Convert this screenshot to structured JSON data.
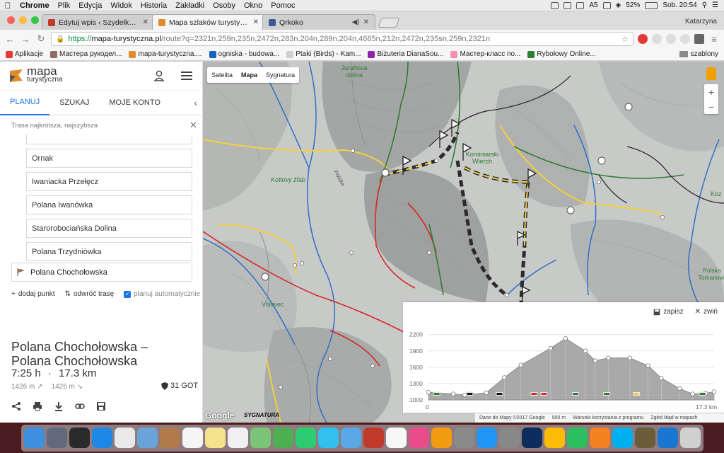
{
  "menubar": {
    "app": "Chrome",
    "items": [
      "Plik",
      "Edycja",
      "Widok",
      "Historia",
      "Zakładki",
      "Osoby",
      "Okno",
      "Pomoc"
    ],
    "battery": "52%",
    "clock": "Sob. 20:54",
    "a_badge": "A5"
  },
  "browser": {
    "tabs": [
      {
        "title": "Edytuj wpis ‹ Szydełko w górac",
        "color": "#c0392b"
      },
      {
        "title": "Mapa szlaków turystycznych",
        "color": "#e08a2b"
      },
      {
        "title": "Qrkoko",
        "color": "#3b5998"
      }
    ],
    "user": "Katarzyna",
    "url_scheme": "https://",
    "url_domain": "mapa-turystyczna.pl",
    "url_path": "/route?q=2321n,259n,235n,2472n,283n,204n,289n,204n,4665n,212n,2472n,235sn,259n,2321n",
    "bookmarks": [
      {
        "label": "Aplikacje",
        "color": "#e53935"
      },
      {
        "label": "Мастера рукодел...",
        "color": "#8d6e63"
      },
      {
        "label": "mapa-turystyczna....",
        "color": "#e08a2b"
      },
      {
        "label": "ogniska - budowa...",
        "color": "#1565c0"
      },
      {
        "label": "Ptaki (Birds) - Kam...",
        "color": "#cfcfcf"
      },
      {
        "label": "Biżuteria DianaSou...",
        "color": "#8e24aa"
      },
      {
        "label": "Мастер-класс по...",
        "color": "#f48fb1"
      },
      {
        "label": "Rybołowy Online...",
        "color": "#2e7d32"
      }
    ],
    "folder": "szablony"
  },
  "sidebar": {
    "logo_line1": "mapa",
    "logo_line2": "turystyczna",
    "tabs": [
      "PLANUJ",
      "SZUKAJ",
      "MOJE KONTO"
    ],
    "route_type": "Trasa najkrótsza, najszybsza",
    "waypoints": [
      "Ornak",
      "Iwaniacka Przełęcz",
      "Polana Iwanówka",
      "Starorobociańska Dolina",
      "Polana Trzydniówka"
    ],
    "destination": "Polana Chochołowska",
    "add_point": "dodaj punkt",
    "reverse": "odwróć trasę",
    "auto_plan": "planuj automatycznie",
    "route_title_1": "Polana Chochołowska –",
    "route_title_2": "Polana Chochołowska",
    "duration": "7:25 h",
    "distance": "17.3 km",
    "ascent": "1426 m ↗",
    "descent": "1426 m ↘",
    "got": "31 GOT"
  },
  "map": {
    "types": [
      "Satelita",
      "Mapa",
      "Sygnatura"
    ],
    "labels": [
      {
        "t": "Juraňova dolina",
        "c": "#2e7d32"
      },
      {
        "t": "Kominiarski Wierch",
        "c": "#2e7d32"
      },
      {
        "t": "Kotlový žľab",
        "c": "#2e7d32"
      },
      {
        "t": "Volovec",
        "c": "#2e7d32"
      },
      {
        "t": "Polska Tomanová",
        "c": "#2e7d32"
      },
      {
        "t": "Polska",
        "c": "#555"
      },
      {
        "t": "Koz",
        "c": "#2e7d32"
      }
    ],
    "footer": [
      "Dane do Mapy ©2017 Google",
      "500 m",
      "Warunki korzystania z programu",
      "Zgłoś błąd w mapach"
    ],
    "google": "Google",
    "sygnatura": "SYGNATURA"
  },
  "elevation": {
    "save": "zapisz",
    "collapse": "zwiń",
    "x_start": "0",
    "x_end": "17.3 km",
    "chart_data": {
      "type": "area",
      "title": "",
      "xlabel": "",
      "ylabel": "",
      "x_unit": "km",
      "y_ticks": [
        1000,
        1300,
        1600,
        1900,
        2200
      ],
      "ylim": [
        1000,
        2300
      ],
      "xlim": [
        0,
        17.3
      ],
      "x": [
        0,
        1.5,
        2.2,
        3.5,
        4.6,
        5.6,
        7.4,
        8.3,
        9.5,
        10.1,
        10.9,
        12.2,
        13.3,
        14.1,
        15.2,
        16.0,
        16.8,
        17.3
      ],
      "values": [
        1140,
        1110,
        1090,
        1130,
        1410,
        1640,
        1950,
        2130,
        1900,
        1720,
        1770,
        1770,
        1630,
        1400,
        1210,
        1110,
        1120,
        1150
      ],
      "markers": [
        {
          "x": 0.5,
          "color": "#2e7d32"
        },
        {
          "x": 2.5,
          "color": "#111111"
        },
        {
          "x": 4.3,
          "color": "#111111"
        },
        {
          "x": 6.4,
          "color": "#d62828"
        },
        {
          "x": 7.0,
          "color": "#d62828"
        },
        {
          "x": 8.9,
          "color": "#2e7d32"
        },
        {
          "x": 10.8,
          "color": "#2e7d32"
        },
        {
          "x": 12.6,
          "color": "#f4d03f"
        },
        {
          "x": 16.6,
          "color": "#2e7d32"
        }
      ]
    }
  },
  "dock": [
    {
      "name": "finder",
      "color": "#3d8fe0"
    },
    {
      "name": "launchpad",
      "color": "#606a7a"
    },
    {
      "name": "mission-control",
      "color": "#2a2a2a"
    },
    {
      "name": "safari",
      "color": "#1e88e5"
    },
    {
      "name": "launch",
      "color": "#e9e9e9"
    },
    {
      "name": "preview",
      "color": "#6aa4d8"
    },
    {
      "name": "contacts",
      "color": "#b07a4a"
    },
    {
      "name": "calendar",
      "color": "#f5f5f5"
    },
    {
      "name": "notes",
      "color": "#f4e38a"
    },
    {
      "name": "reminders",
      "color": "#f0f0f0"
    },
    {
      "name": "maps",
      "color": "#7cc576"
    },
    {
      "name": "photos-app",
      "color": "#4caf50"
    },
    {
      "name": "facetime",
      "color": "#2ecc71"
    },
    {
      "name": "messages",
      "color": "#31c0f0"
    },
    {
      "name": "mail",
      "color": "#5aa8e6"
    },
    {
      "name": "photo-booth",
      "color": "#c0392b"
    },
    {
      "name": "photos",
      "color": "#f7f7f7"
    },
    {
      "name": "itunes",
      "color": "#e94c8a"
    },
    {
      "name": "ibooks",
      "color": "#f39c12"
    },
    {
      "name": "image-capture",
      "color": "#8a8a8a"
    },
    {
      "name": "app-store",
      "color": "#2196f3"
    },
    {
      "name": "system-preferences",
      "color": "#888888"
    },
    {
      "name": "photoshop",
      "color": "#0d2e5c"
    },
    {
      "name": "chrome",
      "color": "#fbbc05"
    },
    {
      "name": "evernote",
      "color": "#2dbe60"
    },
    {
      "name": "vlc",
      "color": "#f58220"
    },
    {
      "name": "skype",
      "color": "#00aff0"
    },
    {
      "name": "gimp",
      "color": "#6b5c3a"
    },
    {
      "name": "downloads",
      "color": "#1976d2"
    },
    {
      "name": "trash",
      "color": "#d0d0d0"
    }
  ]
}
